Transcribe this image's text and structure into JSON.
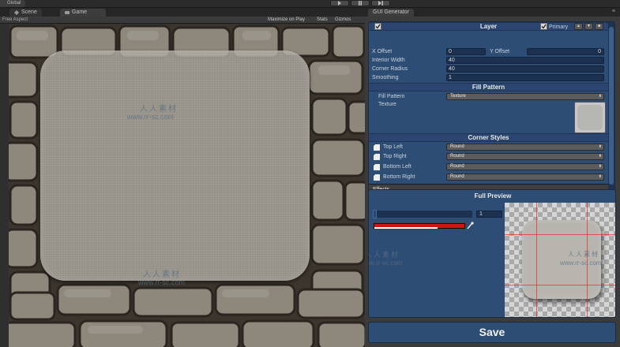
{
  "topbar": {
    "global_tab": "Global"
  },
  "scene_panel": {
    "tabs": [
      {
        "label": "Scene",
        "icon": "scene-icon"
      },
      {
        "label": "Game",
        "icon": "game-icon"
      }
    ],
    "toolbar": {
      "aspect": "Free Aspect",
      "maximize": "Maximize on Play",
      "stats": "Stats",
      "gizmos": "Gizmos"
    }
  },
  "watermark": {
    "cn": "人人素材",
    "url": "www.rr-sc.com"
  },
  "gui_panel": {
    "tab": "GUI Generator",
    "layer": {
      "enabled": true,
      "title": "Layer",
      "primary_label": "Primary",
      "primary_checked": true,
      "up": "▲",
      "down": "▼",
      "remove": "■"
    },
    "fields": {
      "x_offset_label": "X Offset",
      "x_offset": "0",
      "y_offset_label": "Y Offset",
      "y_offset": "0",
      "interior_width_label": "Interior Width",
      "interior_width": "40",
      "corner_radius_label": "Corner Radius",
      "corner_radius": "40",
      "smoothing_label": "Smoothing",
      "smoothing": "1"
    },
    "fill_pattern": {
      "header": "Fill Pattern",
      "label": "Fill Pattern",
      "value": "Texture",
      "texture_label": "Texture"
    },
    "corner_styles": {
      "header": "Corner Styles",
      "items": [
        {
          "label": "Top Left",
          "value": "Round"
        },
        {
          "label": "Top Right",
          "value": "Round"
        },
        {
          "label": "Bottom Left",
          "value": "Round"
        },
        {
          "label": "Bottom Right",
          "value": "Round"
        }
      ]
    },
    "effects": "Effects",
    "preview": {
      "title": "Full Preview",
      "zoom": "1",
      "color": "#d11414"
    },
    "save": "Save"
  }
}
